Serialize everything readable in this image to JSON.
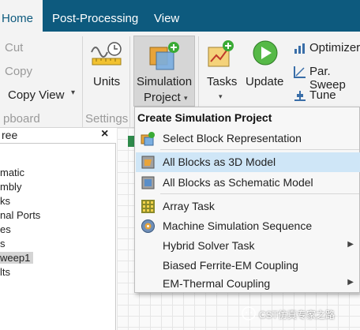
{
  "tabs": [
    {
      "label": "Home"
    },
    {
      "label": "Post-Processing"
    },
    {
      "label": "View"
    }
  ],
  "ribbon": {
    "clipboard": {
      "cut": "Cut",
      "copy": "Copy",
      "copy_view": "Copy View",
      "group": "pboard"
    },
    "settings": {
      "units": "Units",
      "group": "Settings"
    },
    "simulation": {
      "line1": "Simulation",
      "line2": "Project"
    },
    "tasks": "Tasks",
    "update": "Update",
    "small": {
      "optimizer": "Optimizer",
      "par_sweep": "Par. Sweep",
      "tune": "Tune"
    }
  },
  "tree": {
    "search_value": "ree",
    "close": "×",
    "items": [
      "matic",
      "mbly",
      "ks",
      "nal Ports",
      "es",
      "s",
      "weep1",
      "lts"
    ]
  },
  "menu": {
    "title": "Create Simulation Project",
    "items": [
      {
        "label": "Select Block Representation"
      },
      {
        "label": "All Blocks as 3D Model"
      },
      {
        "label": "All Blocks as Schematic Model"
      },
      {
        "label": "Array Task"
      },
      {
        "label": "Machine Simulation Sequence"
      },
      {
        "label": "Hybrid Solver Task"
      },
      {
        "label": "Biased Ferrite-EM Coupling"
      },
      {
        "label": "EM-Thermal Coupling"
      }
    ]
  },
  "watermark": "CST仿真专家之路",
  "colors": {
    "topbar": "#0d5a7e",
    "highlight": "#cfe6f7",
    "ribbon": "#f3f3f3"
  }
}
